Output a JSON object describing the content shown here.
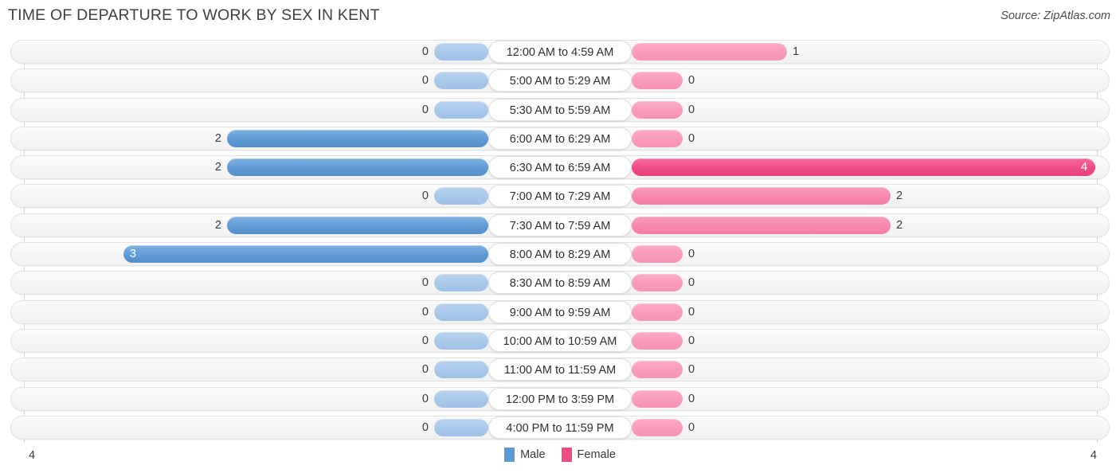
{
  "header": {
    "title": "TIME OF DEPARTURE TO WORK BY SEX IN KENT",
    "source": "Source: ZipAtlas.com"
  },
  "legend": {
    "male_label": "Male",
    "female_label": "Female",
    "male_color": "#5B9BD5",
    "female_color": "#EE4C85"
  },
  "axis": {
    "left_max": "4",
    "right_max": "4"
  },
  "chart_data": {
    "type": "bar",
    "title": "TIME OF DEPARTURE TO WORK BY SEX IN KENT",
    "subtitle": "",
    "xlabel": "",
    "ylabel": "",
    "orientation": "horizontal-diverging",
    "axis_max": 4,
    "xlim": [
      4,
      4
    ],
    "grid": true,
    "legend_position": "bottom-center",
    "categories": [
      "12:00 AM to 4:59 AM",
      "5:00 AM to 5:29 AM",
      "5:30 AM to 5:59 AM",
      "6:00 AM to 6:29 AM",
      "6:30 AM to 6:59 AM",
      "7:00 AM to 7:29 AM",
      "7:30 AM to 7:59 AM",
      "8:00 AM to 8:29 AM",
      "8:30 AM to 8:59 AM",
      "9:00 AM to 9:59 AM",
      "10:00 AM to 10:59 AM",
      "11:00 AM to 11:59 AM",
      "12:00 PM to 3:59 PM",
      "4:00 PM to 11:59 PM"
    ],
    "series": [
      {
        "name": "Male",
        "values": [
          0,
          0,
          0,
          2,
          2,
          0,
          2,
          3,
          0,
          0,
          0,
          0,
          0,
          0
        ]
      },
      {
        "name": "Female",
        "values": [
          1,
          0,
          0,
          0,
          4,
          2,
          2,
          0,
          0,
          0,
          0,
          0,
          0,
          0
        ]
      }
    ]
  },
  "rows": [
    {
      "category": "12:00 AM to 4:59 AM",
      "male": "0",
      "female": "1",
      "male_w": 68,
      "female_w": 195,
      "male_tone": "zero",
      "female_tone": "lighter",
      "male_inside": false,
      "female_inside": false
    },
    {
      "category": "5:00 AM to 5:29 AM",
      "male": "0",
      "female": "0",
      "male_w": 68,
      "female_w": 64,
      "male_tone": "zero",
      "female_tone": "lighter",
      "male_inside": false,
      "female_inside": false
    },
    {
      "category": "5:30 AM to 5:59 AM",
      "male": "0",
      "female": "0",
      "male_w": 68,
      "female_w": 64,
      "male_tone": "zero",
      "female_tone": "lighter",
      "male_inside": false,
      "female_inside": false
    },
    {
      "category": "6:00 AM to 6:29 AM",
      "male": "2",
      "female": "0",
      "male_w": 328,
      "female_w": 64,
      "male_tone": "full",
      "female_tone": "lighter",
      "male_inside": false,
      "female_inside": false
    },
    {
      "category": "6:30 AM to 6:59 AM",
      "male": "2",
      "female": "4",
      "male_w": 328,
      "female_w": 582,
      "male_tone": "full",
      "female_tone": "full",
      "male_inside": false,
      "female_inside": true
    },
    {
      "category": "7:00 AM to 7:29 AM",
      "male": "0",
      "female": "2",
      "male_w": 68,
      "female_w": 325,
      "male_tone": "zero",
      "female_tone": "light",
      "male_inside": false,
      "female_inside": false
    },
    {
      "category": "7:30 AM to 7:59 AM",
      "male": "2",
      "female": "2",
      "male_w": 328,
      "female_w": 325,
      "male_tone": "full",
      "female_tone": "light",
      "male_inside": false,
      "female_inside": false
    },
    {
      "category": "8:00 AM to 8:29 AM",
      "male": "3",
      "female": "0",
      "male_w": 458,
      "female_w": 64,
      "male_tone": "full",
      "female_tone": "lighter",
      "male_inside": true,
      "female_inside": false
    },
    {
      "category": "8:30 AM to 8:59 AM",
      "male": "0",
      "female": "0",
      "male_w": 68,
      "female_w": 64,
      "male_tone": "zero",
      "female_tone": "lighter",
      "male_inside": false,
      "female_inside": false
    },
    {
      "category": "9:00 AM to 9:59 AM",
      "male": "0",
      "female": "0",
      "male_w": 68,
      "female_w": 64,
      "male_tone": "zero",
      "female_tone": "lighter",
      "male_inside": false,
      "female_inside": false
    },
    {
      "category": "10:00 AM to 10:59 AM",
      "male": "0",
      "female": "0",
      "male_w": 68,
      "female_w": 64,
      "male_tone": "zero",
      "female_tone": "lighter",
      "male_inside": false,
      "female_inside": false
    },
    {
      "category": "11:00 AM to 11:59 AM",
      "male": "0",
      "female": "0",
      "male_w": 68,
      "female_w": 64,
      "male_tone": "zero",
      "female_tone": "lighter",
      "male_inside": false,
      "female_inside": false
    },
    {
      "category": "12:00 PM to 3:59 PM",
      "male": "0",
      "female": "0",
      "male_w": 68,
      "female_w": 64,
      "male_tone": "zero",
      "female_tone": "lighter",
      "male_inside": false,
      "female_inside": false
    },
    {
      "category": "4:00 PM to 11:59 PM",
      "male": "0",
      "female": "0",
      "male_w": 68,
      "female_w": 64,
      "male_tone": "zero",
      "female_tone": "lighter",
      "male_inside": false,
      "female_inside": false
    }
  ]
}
